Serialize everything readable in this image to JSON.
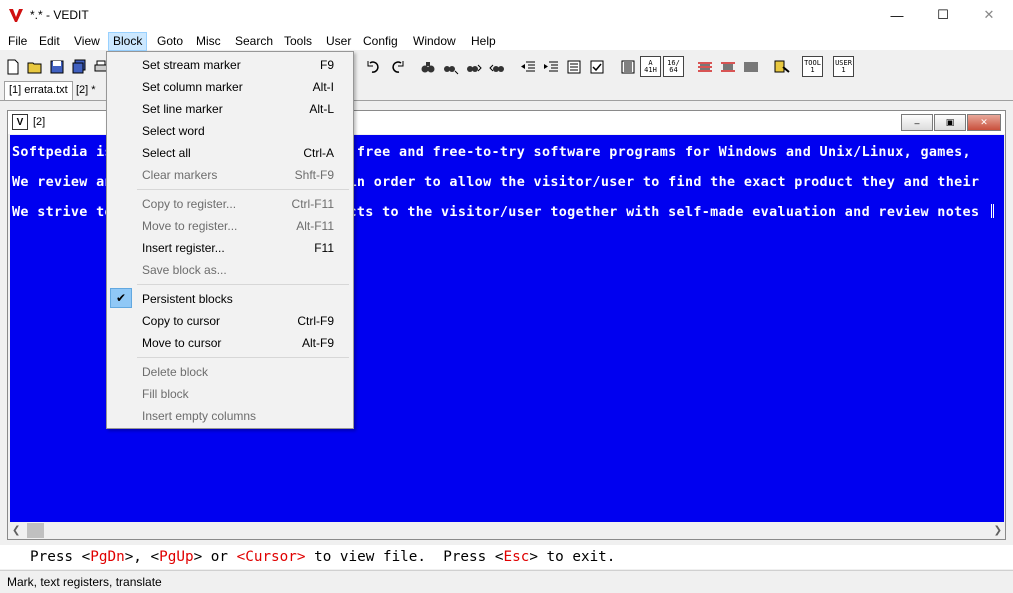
{
  "window": {
    "title": "*.* - VEDIT"
  },
  "menubar": {
    "items": [
      {
        "label": "File"
      },
      {
        "label": "Edit"
      },
      {
        "label": "View"
      },
      {
        "label": "Block"
      },
      {
        "label": "Goto"
      },
      {
        "label": "Misc"
      },
      {
        "label": "Search"
      },
      {
        "label": "Tools"
      },
      {
        "label": "User"
      },
      {
        "label": "Config"
      },
      {
        "label": "Window"
      },
      {
        "label": "Help"
      }
    ]
  },
  "toolbar": {
    "hex_label_top": "A",
    "hex_label_bottom": "41H",
    "num_label_top": "16/",
    "num_label_bottom": "64",
    "tool_label_top": "TOOL",
    "tool_label_bottom": "1",
    "user_label_top": "USER",
    "user_label_bottom": "1"
  },
  "tabs": [
    {
      "label": "[1] errata.txt"
    },
    {
      "label": "[2] *"
    }
  ],
  "child_window": {
    "title": "[2]"
  },
  "editor": {
    "lines": [
      "Softpedia is a library of over 1,300,000 free and free-to-try software programs for Windows and Unix/Linux, games,",
      "We review and categorize these products in order to allow the visitor/user to find the exact product they and their",
      "We strive to deliver only the best products to the visitor/user together with self-made evaluation and review notes"
    ]
  },
  "prompt": {
    "seg1": "Press <",
    "k1": "PgDn",
    "seg2": ">, <",
    "k2": "PgUp",
    "seg3": "> or ",
    "k3": "<Cursor>",
    "seg4": " to view file.  Press <",
    "k4": "Esc",
    "seg5": "> to exit."
  },
  "status": {
    "text": "Mark, text registers, translate"
  },
  "block_menu": {
    "items": [
      {
        "label": "Set stream marker",
        "shortcut": "F9"
      },
      {
        "label": "Set column marker",
        "shortcut": "Alt-I"
      },
      {
        "label": "Set line marker",
        "shortcut": "Alt-L"
      },
      {
        "label": "Select word",
        "shortcut": ""
      },
      {
        "label": "Select all",
        "shortcut": "Ctrl-A"
      },
      {
        "label": "Clear markers",
        "shortcut": "Shft-F9"
      },
      {
        "label": "Copy to register...",
        "shortcut": "Ctrl-F11"
      },
      {
        "label": "Move to register...",
        "shortcut": "Alt-F11"
      },
      {
        "label": "Insert register...",
        "shortcut": "F11"
      },
      {
        "label": "Save block as...",
        "shortcut": ""
      },
      {
        "label": "Persistent blocks",
        "shortcut": "",
        "checked": true
      },
      {
        "label": "Copy to cursor",
        "shortcut": "Ctrl-F9"
      },
      {
        "label": "Move to cursor",
        "shortcut": "Alt-F9"
      },
      {
        "label": "Delete block",
        "shortcut": ""
      },
      {
        "label": "Fill block",
        "shortcut": ""
      },
      {
        "label": "Insert empty columns",
        "shortcut": ""
      }
    ]
  }
}
